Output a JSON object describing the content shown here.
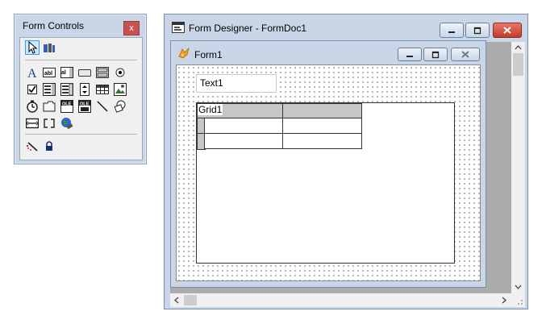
{
  "toolbox": {
    "title": "Form Controls",
    "close_label": "x",
    "tools": [
      "pointer-tool",
      "builder-lock-tool",
      "label-tool",
      "textbox-tool",
      "editbox-tool",
      "commandbutton-tool",
      "commandgroup-tool",
      "optiongroup-tool",
      "checkbox-tool",
      "combobox-tool",
      "listbox-tool",
      "spinner-tool",
      "grid-tool",
      "image-tool",
      "timer-tool",
      "pageframe-tool",
      "oleboundcontrol-tool",
      "olecontainer-tool",
      "line-tool",
      "shape-tool",
      "container-tool",
      "separator-tool",
      "hyperlink-tool",
      "builder-tool",
      "lock-tool"
    ]
  },
  "designer": {
    "title": "Form Designer - FormDoc1"
  },
  "form1": {
    "title": "Form1",
    "text1_label": "Text1",
    "grid1_label": "Grid1"
  },
  "colors": {
    "chrome": "#c9d6e7",
    "close_red": "#c75050",
    "grid_header": "#c6c6c6"
  }
}
